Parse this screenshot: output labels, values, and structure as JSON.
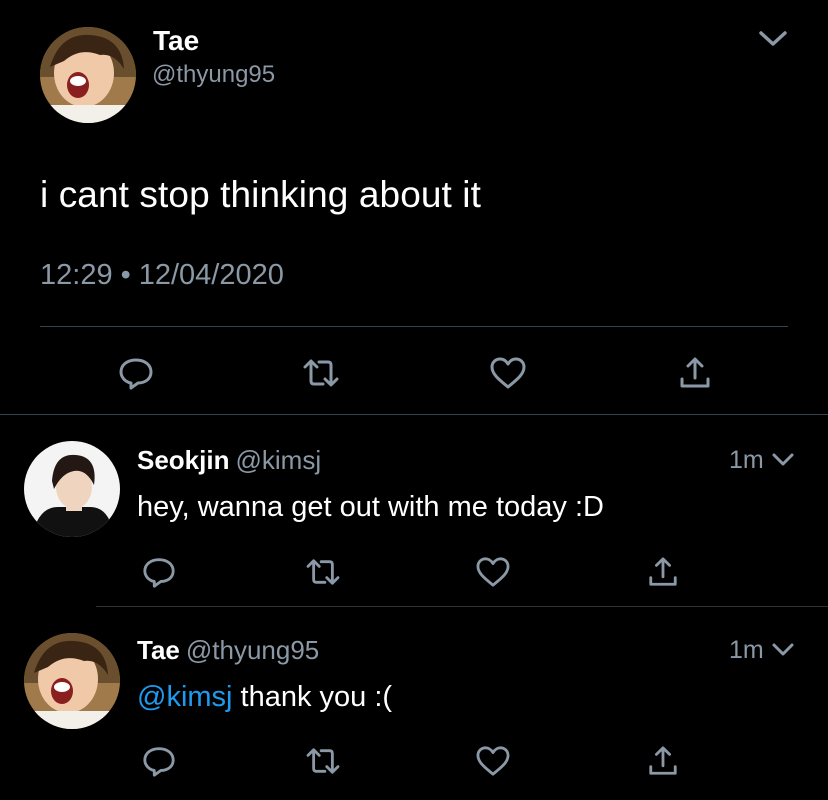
{
  "main_tweet": {
    "author_name": "Tae",
    "author_handle": "@thyung95",
    "text": "i cant stop thinking about it",
    "time": "12:29",
    "separator": "•",
    "date": "12/04/2020",
    "actions": [
      "reply-icon",
      "retweet-icon",
      "like-icon",
      "share-icon"
    ]
  },
  "replies": [
    {
      "author_name": "Seokjin",
      "author_handle": "@kimsj",
      "time": "1m",
      "text": "hey, wanna get out with me today :D",
      "actions": [
        "reply-icon",
        "retweet-icon",
        "like-icon",
        "share-icon"
      ]
    },
    {
      "author_name": "Tae",
      "author_handle": "@thyung95",
      "time": "1m",
      "mention": "@kimsj",
      "text": " thank you :(",
      "actions": [
        "reply-icon",
        "retweet-icon",
        "like-icon",
        "share-icon"
      ]
    }
  ],
  "colors": {
    "background": "#000000",
    "text": "#ffffff",
    "secondary": "#8b98a5",
    "mention": "#1d9bf0",
    "divider": "#38444d"
  }
}
